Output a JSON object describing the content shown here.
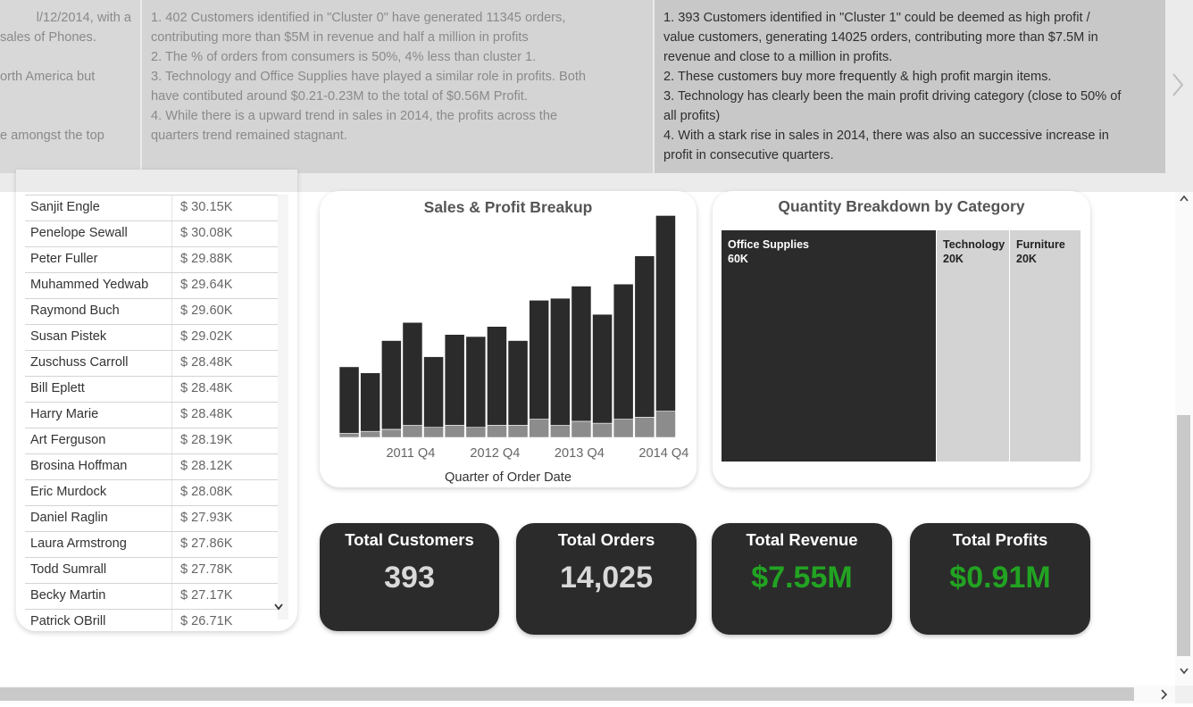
{
  "insights": {
    "left_lines": [
      "l/12/2014, with a",
      "sales of Phones.",
      "",
      "orth America but",
      "",
      "",
      "e amongst the top"
    ],
    "middle_lines": [
      "1. 402 Customers identified in \"Cluster 0\" have generated 11345 orders,",
      "contributing more than $5M in revenue and half a million in profits",
      "2. The % of orders from consumers is 50%, 4% less than cluster 1.",
      "3. Technology and Office Supplies have played a similar role in profits. Both",
      "have contibuted around $0.21-0.23M to the total of $0.56M Profit.",
      "4. While there is a upward trend in sales in 2014, the profits across the",
      "quarters trend remained stagnant."
    ],
    "right_lines": [
      "1. 393 Customers identified in \"Cluster 1\" could be deemed as high profit /",
      "value customers, generating 14025 orders, contributing more than $7.5M in",
      "revenue and close to a million in profits.",
      "2. These customers buy more frequently & high profit margin items.",
      "3. Technology has clearly been the main profit driving category (close to 50% of",
      "all profits)",
      "4. With a stark rise in sales in 2014, there was also an successive increase in",
      "profit in consecutive quarters."
    ],
    "next_icon": "chevron-right-icon"
  },
  "customers": [
    {
      "name": "Sanjit Engle",
      "value": "$ 30.15K"
    },
    {
      "name": "Penelope Sewall",
      "value": "$ 30.08K"
    },
    {
      "name": "Peter Fuller",
      "value": "$ 29.88K"
    },
    {
      "name": "Muhammed Yedwab",
      "value": "$ 29.64K"
    },
    {
      "name": "Raymond Buch",
      "value": "$ 29.60K"
    },
    {
      "name": "Susan Pistek",
      "value": "$ 29.02K"
    },
    {
      "name": "Zuschuss Carroll",
      "value": "$ 28.48K"
    },
    {
      "name": "Bill Eplett",
      "value": "$ 28.48K"
    },
    {
      "name": "Harry Marie",
      "value": "$ 28.48K"
    },
    {
      "name": "Art Ferguson",
      "value": "$ 28.19K"
    },
    {
      "name": "Brosina Hoffman",
      "value": "$ 28.12K"
    },
    {
      "name": "Eric Murdock",
      "value": "$ 28.08K"
    },
    {
      "name": "Daniel Raglin",
      "value": "$ 27.93K"
    },
    {
      "name": "Laura Armstrong",
      "value": "$ 27.86K"
    },
    {
      "name": "Todd Sumrall",
      "value": "$ 27.78K"
    },
    {
      "name": "Becky Martin",
      "value": "$ 27.17K"
    },
    {
      "name": "Patrick OBrill",
      "value": "$ 26.71K"
    }
  ],
  "chart_data": [
    {
      "type": "bar",
      "title": "Sales & Profit Breakup",
      "xlabel": "Quarter of Order Date",
      "ylabel": "",
      "x_tick_labels": [
        "2011 Q4",
        "2012 Q4",
        "2013 Q4",
        "2014 Q4"
      ],
      "categories": [
        "2011 Q1",
        "2011 Q2",
        "2011 Q3",
        "2011 Q4",
        "2012 Q1",
        "2012 Q2",
        "2012 Q3",
        "2012 Q4",
        "2013 Q1",
        "2013 Q2",
        "2013 Q3",
        "2013 Q4",
        "2014 Q1",
        "2014 Q2",
        "2014 Q3",
        "2014 Q4"
      ],
      "stacked": true,
      "ylim": [
        0,
        100
      ],
      "series": [
        {
          "color": "#2b2b2b",
          "values": [
            33,
            29,
            44,
            51,
            35,
            45,
            45,
            49,
            42,
            59,
            63,
            67,
            54,
            67,
            80,
            97
          ]
        },
        {
          "color": "#8c8c8c",
          "values": [
            2,
            3,
            4,
            6,
            5,
            6,
            5,
            6,
            6,
            9,
            6,
            8,
            7,
            9,
            10,
            13
          ]
        }
      ],
      "grid": false,
      "legend": "none"
    },
    {
      "type": "treemap",
      "title": "Quantity Breakdown by Category",
      "categories": [
        "Office Supplies",
        "Technology",
        "Furniture"
      ],
      "values": [
        60,
        20,
        20
      ],
      "labels": [
        "60K",
        "20K",
        "20K"
      ],
      "colors": [
        "#2b2b2b",
        "#d3d3d3",
        "#d3d3d3"
      ]
    }
  ],
  "kpis": [
    {
      "label": "Total Customers",
      "value": "393",
      "color": "#d9d9d9"
    },
    {
      "label": "Total Orders",
      "value": "14,025",
      "color": "#d9d9d9"
    },
    {
      "label": "Total Revenue",
      "value": "$7.55M",
      "color": "#22a322"
    },
    {
      "label": "Total Profits",
      "value": "$0.91M",
      "color": "#22a322"
    }
  ]
}
